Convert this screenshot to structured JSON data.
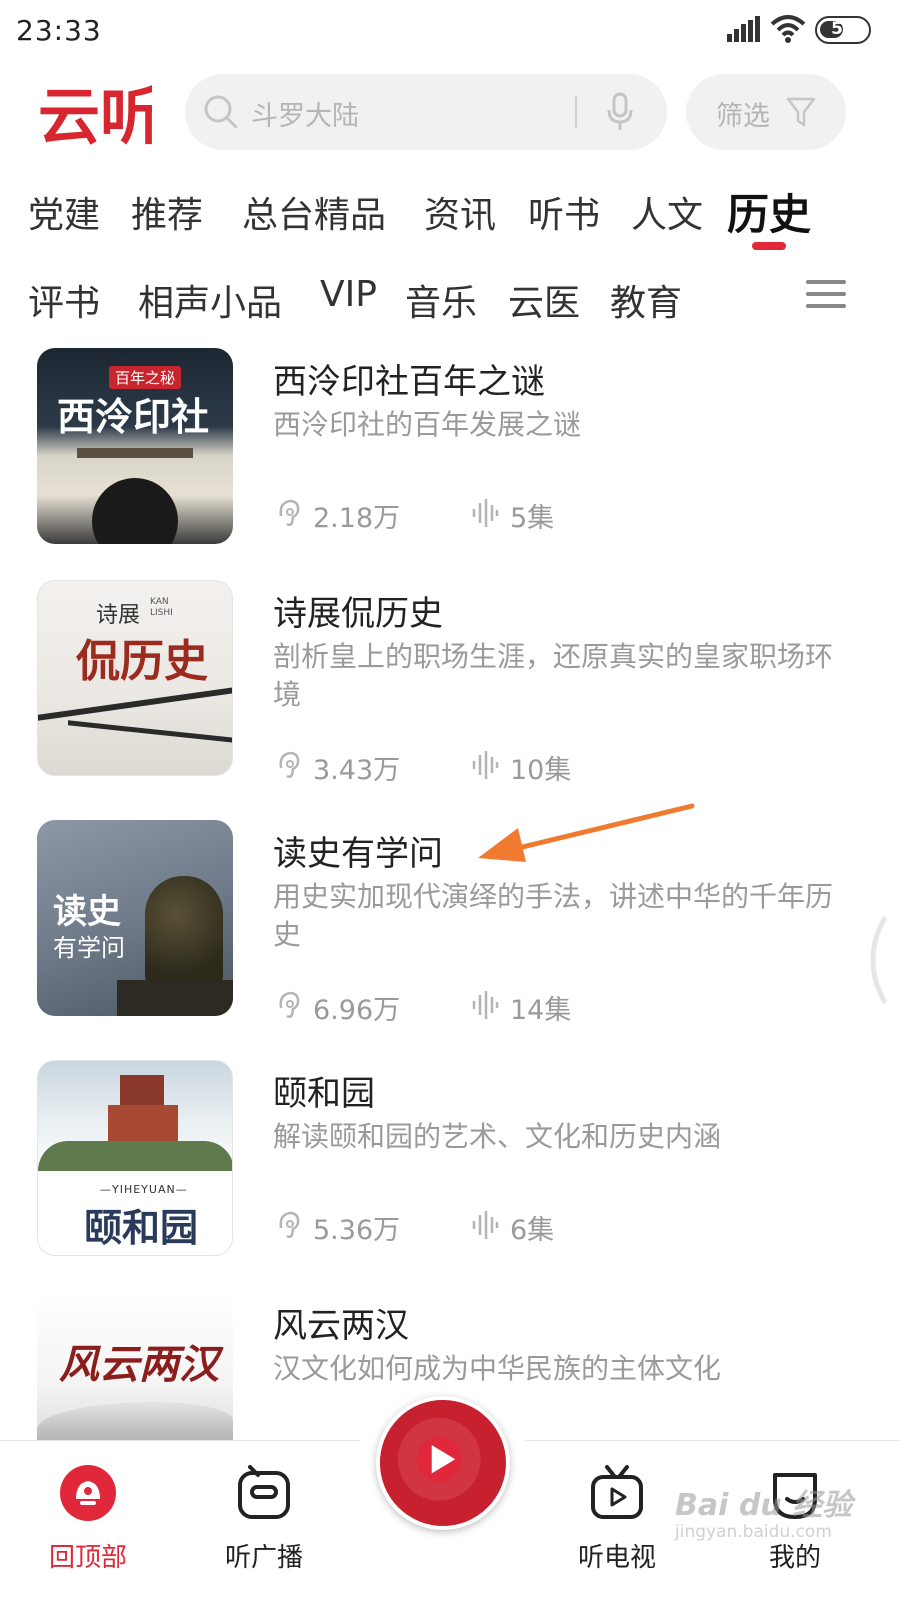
{
  "status_bar": {
    "time": "23:33",
    "battery": "51",
    "battery_level": 0.51
  },
  "header": {
    "logo_text": "云听",
    "search_placeholder": "斗罗大陆",
    "filter_label": "筛选"
  },
  "tabs_primary": [
    "党建",
    "推荐",
    "总台精品",
    "资讯",
    "听书",
    "人文",
    "历史"
  ],
  "tabs_secondary": [
    "评书",
    "相声小品",
    "VIP",
    "音乐",
    "云医",
    "教育"
  ],
  "active_tab": "历史",
  "colors": {
    "accent": "#e0283a",
    "annotation": "#f07a30"
  },
  "list": [
    {
      "title": "西泠印社百年之谜",
      "desc": "西泠印社的百年发展之谜",
      "plays": "2.18万",
      "episodes": "5集",
      "cover_title": "西泠印社",
      "cover_badge": "百年之秘"
    },
    {
      "title": "诗展侃历史",
      "desc": "剖析皇上的职场生涯，还原真实的皇家职场环境",
      "plays": "3.43万",
      "episodes": "10集",
      "cover_title": "侃历史",
      "cover_sub": "诗展",
      "cover_pinyin": "KAN LISHI"
    },
    {
      "title": "读史有学问",
      "desc": "用史实加现代演绎的手法，讲述中华的千年历史",
      "plays": "6.96万",
      "episodes": "14集",
      "cover_title": "读史",
      "cover_sub": "有学问"
    },
    {
      "title": "颐和园",
      "desc": "解读颐和园的艺术、文化和历史内涵",
      "plays": "5.36万",
      "episodes": "6集",
      "cover_title": "颐和园",
      "cover_pinyin": "—YIHEYUAN—"
    },
    {
      "title": "风云两汉",
      "desc": "汉文化如何成为中华民族的主体文化",
      "plays": "",
      "episodes": "",
      "cover_title": "风云两汉"
    }
  ],
  "bottom_nav": {
    "items": [
      "回顶部",
      "听广播",
      "听电视",
      "我的"
    ],
    "center_icon": "play-disc-icon"
  },
  "watermark": {
    "title": "Bai du 经验",
    "sub": "jingyan.baidu.com"
  }
}
